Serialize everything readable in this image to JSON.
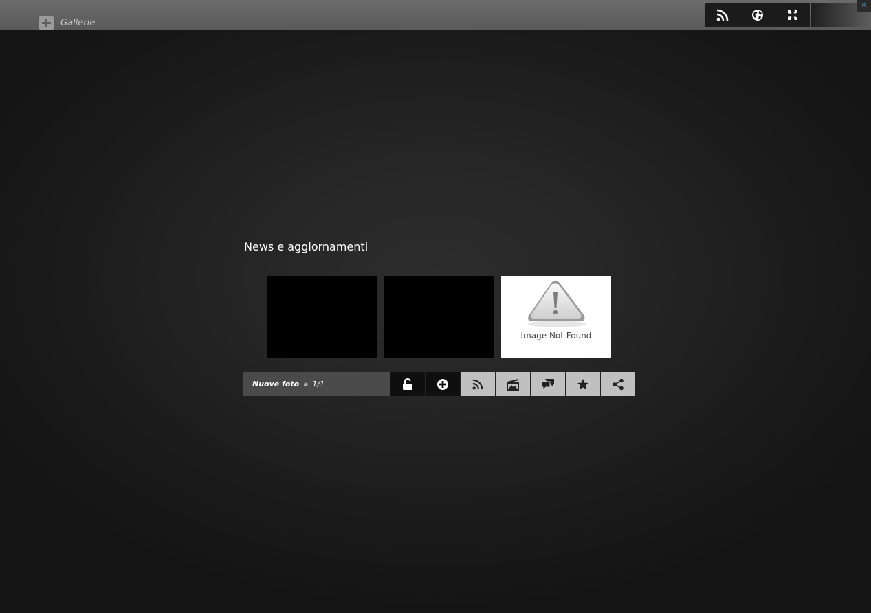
{
  "header": {
    "gallerie_label": "Gallerie",
    "close_label": "×",
    "icons": [
      "rss-icon",
      "globe-icon",
      "fullscreen-icon"
    ]
  },
  "main": {
    "section_title": "News e aggiornamenti",
    "thumbnails": [
      {
        "kind": "black"
      },
      {
        "kind": "black"
      },
      {
        "kind": "image-not-found",
        "caption": "Image Not Found"
      }
    ],
    "toolbar": {
      "label": "Nuove foto",
      "separator": "»",
      "page": "1/1",
      "buttons": [
        "lock-icon",
        "plus-circle-icon",
        "rss-icon",
        "slideshow-icon",
        "comments-icon",
        "star-icon",
        "share-icon"
      ]
    }
  },
  "colors": {
    "topbar": "#5f5f5f",
    "dark_button": "#1b1b1b",
    "light_button": "#c0c0c0",
    "info_box": "#4a4a4a",
    "close_accent": "#4aa3d8"
  }
}
